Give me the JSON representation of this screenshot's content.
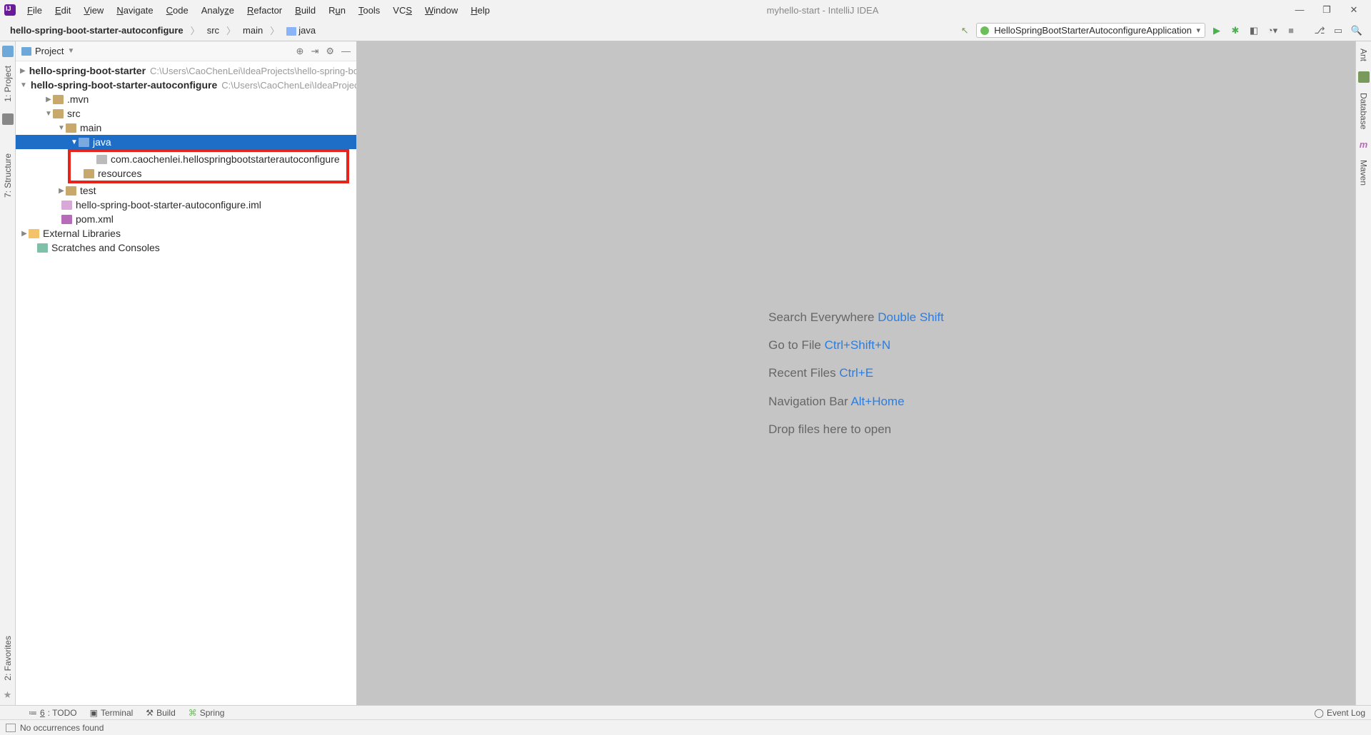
{
  "window": {
    "title": "myhello-start - IntelliJ IDEA"
  },
  "menus": [
    "File",
    "Edit",
    "View",
    "Navigate",
    "Code",
    "Analyze",
    "Refactor",
    "Build",
    "Run",
    "Tools",
    "VCS",
    "Window",
    "Help"
  ],
  "breadcrumb": {
    "root": "hello-spring-boot-starter-autoconfigure",
    "p1": "src",
    "p2": "main",
    "p3": "java"
  },
  "runconfig": "HelloSpringBootStarterAutoconfigureApplication",
  "project_panel": {
    "title": "Project"
  },
  "tree": {
    "row0": {
      "name": "hello-spring-boot-starter",
      "path": "C:\\Users\\CaoChenLei\\IdeaProjects\\hello-spring-bo"
    },
    "row1": {
      "name": "hello-spring-boot-starter-autoconfigure",
      "path": "C:\\Users\\CaoChenLei\\IdeaProjects"
    },
    "row2": {
      "name": ".mvn"
    },
    "row3": {
      "name": "src"
    },
    "row4": {
      "name": "main"
    },
    "row5": {
      "name": "java"
    },
    "row6": {
      "name": "com.caochenlei.hellospringbootstarterautoconfigure"
    },
    "row7": {
      "name": "resources"
    },
    "row8": {
      "name": "test"
    },
    "row9": {
      "name": "hello-spring-boot-starter-autoconfigure.iml"
    },
    "row10": {
      "name": "pom.xml"
    },
    "row11": {
      "name": "External Libraries"
    },
    "row12": {
      "name": "Scratches and Consoles"
    }
  },
  "hints": {
    "l1a": "Search Everywhere ",
    "l1b": "Double Shift",
    "l2a": "Go to File ",
    "l2b": "Ctrl+Shift+N",
    "l3a": "Recent Files ",
    "l3b": "Ctrl+E",
    "l4a": "Navigation Bar ",
    "l4b": "Alt+Home",
    "l5": "Drop files here to open"
  },
  "left_gutter": {
    "project": "1: Project",
    "structure": "7: Structure",
    "favorites": "2: Favorites"
  },
  "right_gutter": {
    "ant": "Ant",
    "database": "Database",
    "maven": "Maven"
  },
  "bottom_tabs": {
    "todo": "6: TODO",
    "terminal": "Terminal",
    "build": "Build",
    "spring": "Spring",
    "eventlog": "Event Log"
  },
  "statusbar": {
    "msg": "No occurrences found"
  }
}
